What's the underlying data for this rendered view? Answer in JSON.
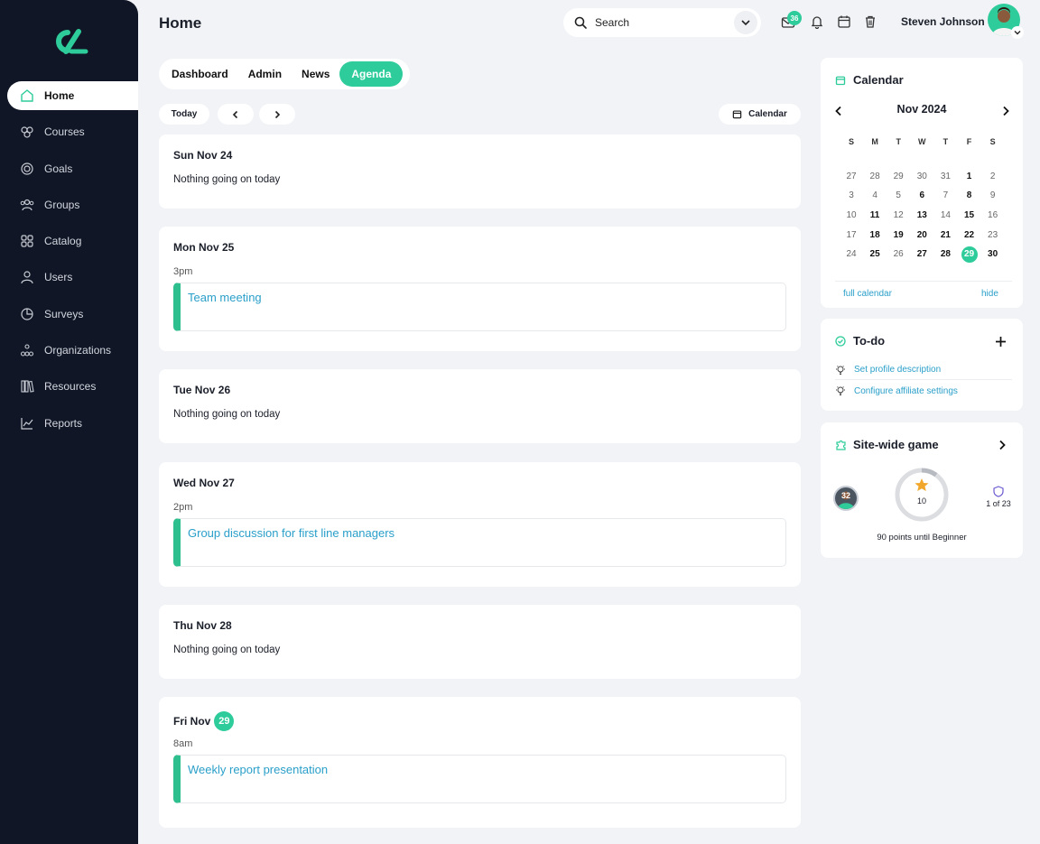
{
  "app": {
    "page_title": "Home"
  },
  "sidebar": {
    "items": [
      {
        "label": "Home",
        "icon": "home-icon"
      },
      {
        "label": "Courses",
        "icon": "courses-icon"
      },
      {
        "label": "Goals",
        "icon": "target-icon"
      },
      {
        "label": "Groups",
        "icon": "groups-icon"
      },
      {
        "label": "Catalog",
        "icon": "grid-icon"
      },
      {
        "label": "Users",
        "icon": "user-icon"
      },
      {
        "label": "Surveys",
        "icon": "pie-icon"
      },
      {
        "label": "Organizations",
        "icon": "org-icon"
      },
      {
        "label": "Resources",
        "icon": "books-icon"
      },
      {
        "label": "Reports",
        "icon": "chart-icon"
      }
    ]
  },
  "header": {
    "search_placeholder": "Search",
    "mail_count": "36",
    "user_name": "Steven Johnson"
  },
  "tabs": [
    "Dashboard",
    "Admin",
    "News",
    "Agenda"
  ],
  "toolbar": {
    "today_label": "Today",
    "calendar_label": "Calendar"
  },
  "agenda": [
    {
      "day": "Sun Nov 24",
      "note": "Nothing going on today"
    },
    {
      "day": "Mon Nov 25",
      "time": "3pm",
      "event": "Team meeting"
    },
    {
      "day": "Tue Nov 26",
      "note": "Nothing going on today"
    },
    {
      "day": "Wed Nov 27",
      "time": "2pm",
      "event": "Group discussion for first line managers"
    },
    {
      "day": "Thu Nov 28",
      "note": "Nothing going on today"
    },
    {
      "day": "Fri Nov",
      "day_badge": "29",
      "time": "8am",
      "event": "Weekly report presentation"
    }
  ],
  "calendar": {
    "title": "Calendar",
    "month": "Nov 2024",
    "weekdays": [
      "S",
      "M",
      "T",
      "W",
      "T",
      "F",
      "S"
    ],
    "weeks": [
      [
        "27",
        "28",
        "29",
        "30",
        "31",
        "1",
        "2"
      ],
      [
        "3",
        "4",
        "5",
        "6",
        "7",
        "8",
        "9"
      ],
      [
        "10",
        "11",
        "12",
        "13",
        "14",
        "15",
        "16"
      ],
      [
        "17",
        "18",
        "19",
        "20",
        "21",
        "22",
        "23"
      ],
      [
        "24",
        "25",
        "26",
        "27",
        "28",
        "29",
        "30"
      ]
    ],
    "bold_dates": [
      "28",
      "30",
      "1",
      "6",
      "8",
      "11",
      "13",
      "15",
      "18",
      "19",
      "20",
      "21",
      "22",
      "25",
      "27"
    ],
    "today": "29",
    "full_calendar_label": "full calendar",
    "hide_label": "hide"
  },
  "todo": {
    "title": "To-do",
    "items": [
      "Set profile description",
      "Configure affiliate settings"
    ]
  },
  "game": {
    "title": "Site-wide game",
    "avatar_level": "32",
    "points": "10",
    "rank": "1 of 23",
    "progress_text": "90 points until Beginner",
    "progress_fraction": 0.1
  },
  "colors": {
    "accent": "#2ecc9a",
    "sidebar": "#101626",
    "link": "#2a9fc9"
  }
}
